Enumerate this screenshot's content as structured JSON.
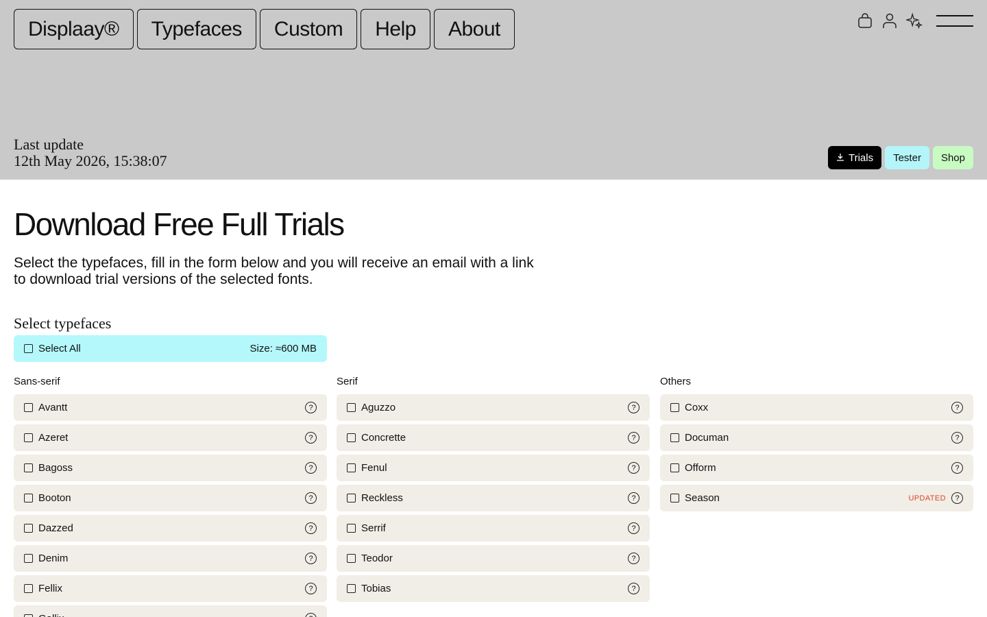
{
  "nav": {
    "items": [
      "Displaay®",
      "Typefaces",
      "Custom",
      "Help",
      "About"
    ]
  },
  "header_icons": [
    "bag-icon",
    "user-icon",
    "sparkle-icon",
    "menu-icon"
  ],
  "last_update": {
    "label": "Last update",
    "value": "12th May 2026, 15:38:07"
  },
  "actions": {
    "trials": "Trials",
    "tester": "Tester",
    "shop": "Shop"
  },
  "page": {
    "title": "Download Free Full Trials",
    "intro": "Select the typefaces, fill in the form below and you will receive an email with a link to download trial versions of the selected fonts.",
    "section_title": "Select typefaces"
  },
  "select_all": {
    "label": "Select All",
    "size": "Size: ≈600 MB"
  },
  "columns": [
    {
      "heading": "Sans-serif",
      "items": [
        {
          "name": "Avantt"
        },
        {
          "name": "Azeret"
        },
        {
          "name": "Bagoss"
        },
        {
          "name": "Booton"
        },
        {
          "name": "Dazzed"
        },
        {
          "name": "Denim"
        },
        {
          "name": "Fellix"
        },
        {
          "name": "Gallix"
        }
      ]
    },
    {
      "heading": "Serif",
      "items": [
        {
          "name": "Aguzzo"
        },
        {
          "name": "Concrette"
        },
        {
          "name": "Fenul"
        },
        {
          "name": "Reckless"
        },
        {
          "name": "Serrif"
        },
        {
          "name": "Teodor"
        },
        {
          "name": "Tobias"
        }
      ]
    },
    {
      "heading": "Others",
      "items": [
        {
          "name": "Coxx"
        },
        {
          "name": "Documan"
        },
        {
          "name": "Ofform"
        },
        {
          "name": "Season",
          "badge": "UPDATED"
        }
      ]
    }
  ],
  "colors": {
    "header_bg": "#c9c9c9",
    "row_bg": "#f0eee6",
    "select_all_bg": "#b4f8fb",
    "tester_bg": "#b4f5fa",
    "shop_bg": "#c7fbc2",
    "badge": "#e0452a"
  }
}
